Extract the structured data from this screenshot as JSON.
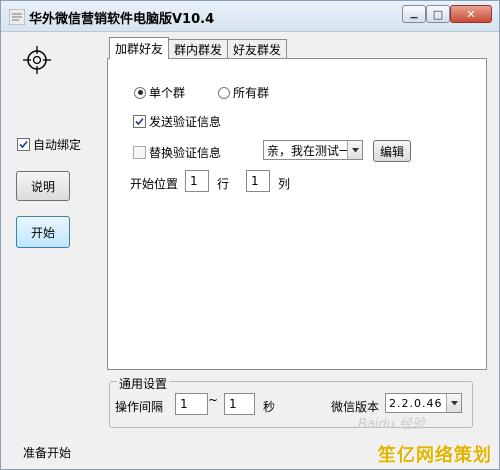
{
  "window": {
    "title": "华外微信营销软件电脑版V10.4",
    "minimize_glyph": "▁",
    "maximize_glyph": "□",
    "close_glyph": "✕"
  },
  "left": {
    "auto_bind_label": "自动绑定",
    "auto_bind_checked": true,
    "help_button": "说明",
    "start_button": "开始"
  },
  "tabs": [
    "加群好友",
    "群内群发",
    "好友群发"
  ],
  "panel": {
    "radio_single": "单个群",
    "radio_all": "所有群",
    "radio_selected": "单个群",
    "send_verify_label": "发送验证信息",
    "send_verify_checked": true,
    "replace_verify_label": "替换验证信息",
    "replace_verify_checked": false,
    "verify_select_value": "亲，我在测试一",
    "edit_button": "编辑",
    "start_pos_label": "开始位置",
    "row_value": "1",
    "row_unit": "行",
    "col_value": "1",
    "col_unit": "列"
  },
  "common": {
    "group_title": "通用设置",
    "interval_label": "操作间隔",
    "interval_from": "1",
    "interval_sep": "~",
    "interval_to": "1",
    "interval_unit": "秒",
    "wechat_version_label": "微信版本",
    "wechat_version_value": "2.2.0.46"
  },
  "status": {
    "text": "准备开始"
  },
  "watermark": "Baidu 经验",
  "brand": "笙亿网络策划"
}
